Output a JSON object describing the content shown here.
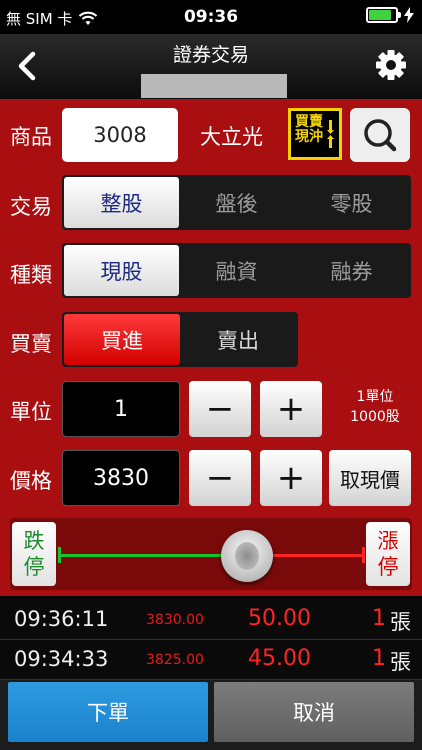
{
  "status": {
    "carrier": "無 SIM 卡",
    "time": "09:36",
    "battery_percent": 85,
    "wifi_icon": "wifi-icon",
    "charging_icon": "bolt-icon"
  },
  "nav": {
    "title": "證券交易",
    "back_icon": "chevron-left-icon",
    "settings_icon": "gear-icon"
  },
  "form": {
    "product": {
      "label": "商品",
      "code": "3008",
      "name": "大立光"
    },
    "daytrade": {
      "line1": "買賣",
      "line2": "現沖"
    },
    "trade_type": {
      "label": "交易",
      "options": [
        "整股",
        "盤後",
        "零股"
      ],
      "selected": 0
    },
    "category": {
      "label": "種類",
      "options": [
        "現股",
        "融資",
        "融券"
      ],
      "selected": 0
    },
    "side": {
      "label": "買賣",
      "options": [
        "買進",
        "賣出"
      ],
      "selected": 0
    },
    "unit": {
      "label": "單位",
      "value": "1",
      "note_line1": "1單位",
      "note_line2": "1000股"
    },
    "price": {
      "label": "價格",
      "value": "3830",
      "get_quote_label": "取現價"
    },
    "minus": "−",
    "plus": "+",
    "limit_down": {
      "line1": "跌",
      "line2": "停"
    },
    "limit_up": {
      "line1": "漲",
      "line2": "停"
    }
  },
  "trades": [
    {
      "time": "09:36:11",
      "price": "3830.00",
      "change": "50.00",
      "qty": "1",
      "unit": "張"
    },
    {
      "time": "09:34:33",
      "price": "3825.00",
      "change": "45.00",
      "qty": "1",
      "unit": "張"
    }
  ],
  "actions": {
    "order": "下單",
    "cancel": "取消"
  },
  "colors": {
    "panel_red": "#a90e10",
    "selected_text": "#1c2a80",
    "buy_red": "#ff3a3a",
    "order_blue": "#2e9be0",
    "limit_down_green": "#1e8a2c",
    "limit_up_red": "#d40000"
  }
}
